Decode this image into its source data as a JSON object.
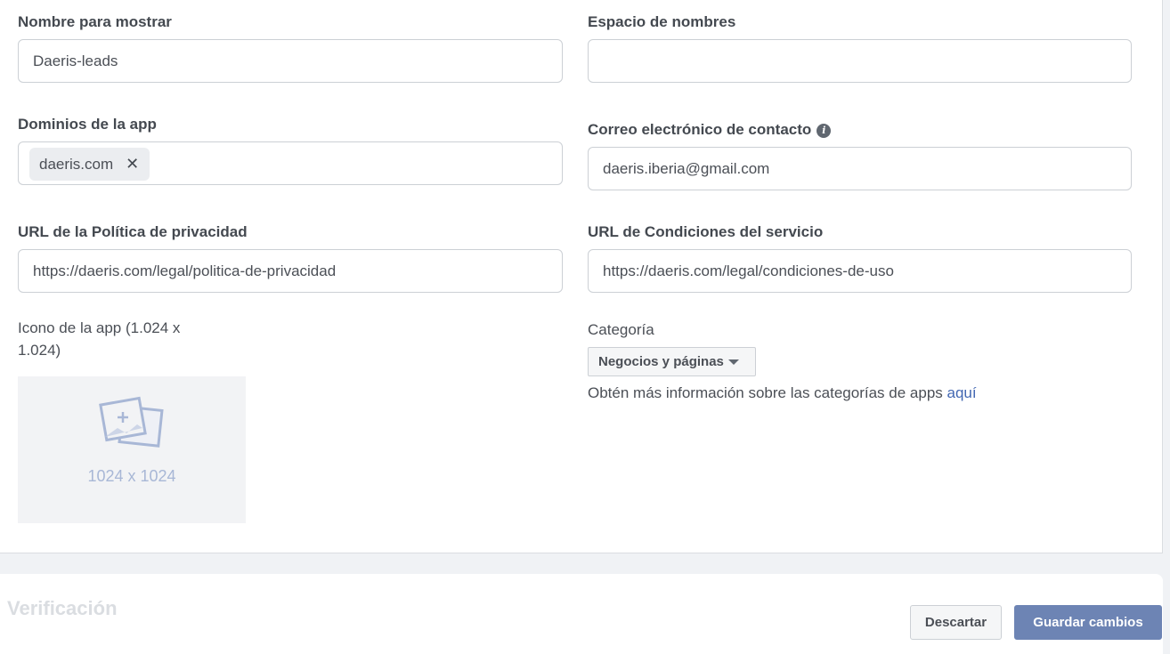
{
  "fields": {
    "display_name": {
      "label": "Nombre para mostrar",
      "value": "Daeris-leads"
    },
    "namespace": {
      "label": "Espacio de nombres",
      "value": ""
    },
    "app_domains": {
      "label": "Dominios de la app",
      "chips": [
        "daeris.com"
      ],
      "remove_glyph": "✕"
    },
    "contact_email": {
      "label": "Correo electrónico de contacto",
      "info_glyph": "i",
      "value": "daeris.iberia@gmail.com"
    },
    "privacy_url": {
      "label": "URL de la Política de privacidad",
      "value": "https://daeris.com/legal/politica-de-privacidad"
    },
    "terms_url": {
      "label": "URL de Condiciones del servicio",
      "value": "https://daeris.com/legal/condiciones-de-uso"
    }
  },
  "app_icon": {
    "label_line1": "Icono de la app (1.024 x",
    "label_line2": "1.024)",
    "placeholder_dims": "1024 x 1024",
    "icon": "add-image-icon"
  },
  "category": {
    "label": "Categoría",
    "selected": "Negocios y páginas",
    "help_text": "Obtén más información sobre las categorías de apps ",
    "help_link": "aquí"
  },
  "verification": {
    "title": "Verificación"
  },
  "actions": {
    "discard": "Descartar",
    "save": "Guardar cambios"
  },
  "colors": {
    "primary_button": "#6d84b4",
    "link": "#4267b2",
    "placeholder": "#a8b7d6"
  }
}
